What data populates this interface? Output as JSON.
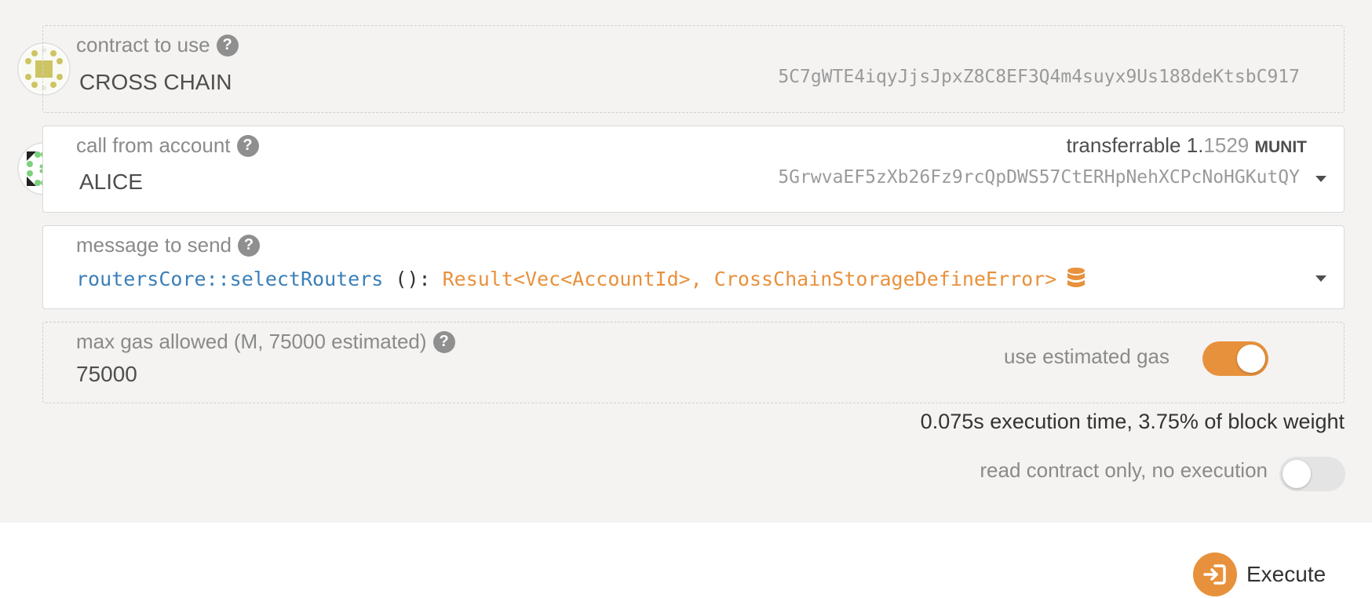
{
  "contract": {
    "label": "contract to use",
    "name": "CROSS CHAIN",
    "address": "5C7gWTE4iqyJjsJpxZ8C8EF3Q4m4suyx9Us188deKtsbC917"
  },
  "account": {
    "label": "call from account",
    "name": "ALICE",
    "address": "5GrwvaEF5zXb26Fz9rcQpDWS57CtERHpNehXCPcNoHGKutQY",
    "balance_label": "transferrable",
    "balance_major": "1.",
    "balance_minor": "1529",
    "balance_unit": "MUNIT"
  },
  "message": {
    "label": "message to send",
    "method": "routersCore::selectRouters",
    "params": " (): ",
    "returns": "Result<Vec<AccountId>, CrossChainStorageDefineError>"
  },
  "gas": {
    "label": "max gas allowed (M, 75000 estimated)",
    "value": "75000",
    "estimated_label": "use estimated gas",
    "estimated_enabled": true
  },
  "execution_info": "0.075s execution time, 3.75% of block weight",
  "read_only": {
    "label": "read contract only, no execution",
    "enabled": false
  },
  "execute_button": "Execute",
  "help_glyph": "?",
  "icons": {
    "help": "question-circle-icon",
    "dropdown": "chevron-down-icon",
    "storage": "database-icon",
    "execute": "sign-in-icon"
  },
  "colors": {
    "accent": "#e8913c",
    "method": "#3b7fb8",
    "returns": "#e8913c"
  }
}
